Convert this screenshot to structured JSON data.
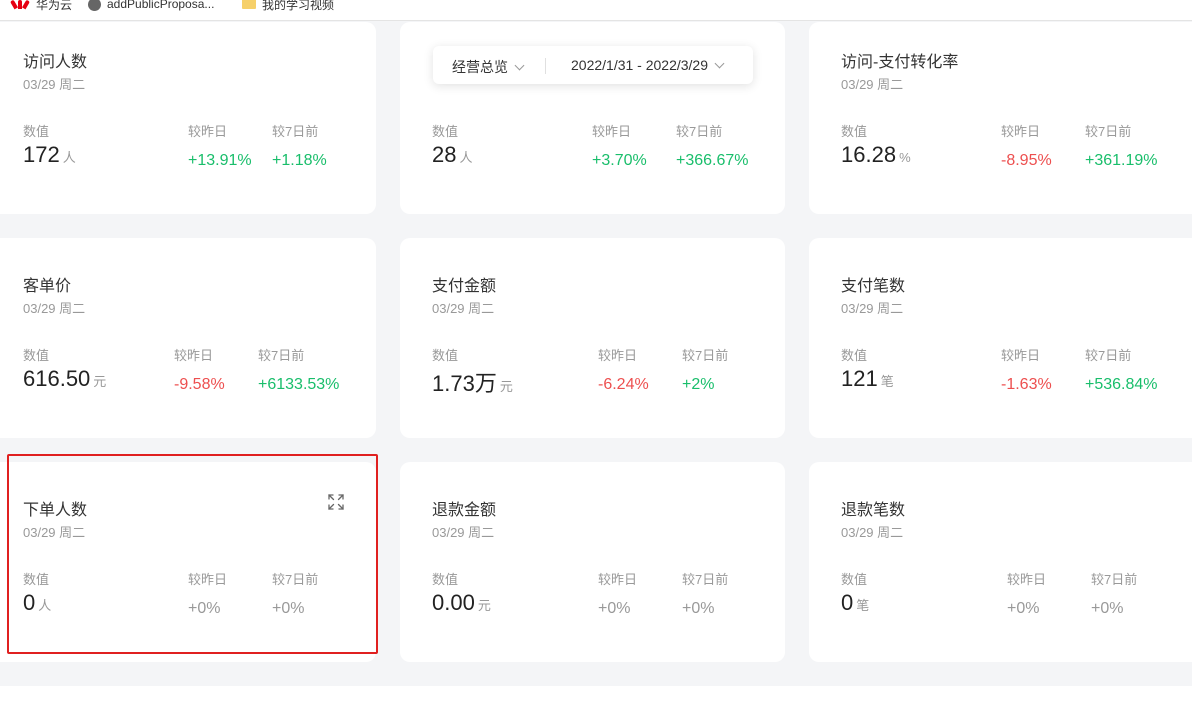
{
  "bookmarks": [
    {
      "label": "华为云",
      "icon": "huawei-icon"
    },
    {
      "label": "addPublicProposa...",
      "icon": "globe-icon"
    },
    {
      "label": "我的学习视频",
      "icon": "folder-icon"
    }
  ],
  "filter": {
    "select_label": "经营总览",
    "date_range": "2022/1/31 - 2022/3/29"
  },
  "labels": {
    "value": "数值",
    "vs_yesterday": "较昨日",
    "vs_7days": "较7日前"
  },
  "cards": [
    {
      "title": "访问人数",
      "date": "03/29 周二",
      "value": "172",
      "unit": "人",
      "day": "+13.91%",
      "week": "+1.18%"
    },
    {
      "title": "",
      "date": "",
      "value": "28",
      "unit": "人",
      "day": "+3.70%",
      "week": "+366.67%"
    },
    {
      "title": "访问-支付转化率",
      "date": "03/29 周二",
      "value": "16.28",
      "unit": "%",
      "day": "-8.95%",
      "week": "+361.19%"
    },
    {
      "title": "客单价",
      "date": "03/29 周二",
      "value": "616.50",
      "unit": "元",
      "day": "-9.58%",
      "week": "+6133.53%"
    },
    {
      "title": "支付金额",
      "date": "03/29 周二",
      "value": "1.73万",
      "unit": "元",
      "day": "-6.24%",
      "week": "+2%"
    },
    {
      "title": "支付笔数",
      "date": "03/29 周二",
      "value": "121",
      "unit": "笔",
      "day": "-1.63%",
      "week": "+536.84%"
    },
    {
      "title": "下单人数",
      "date": "03/29 周二",
      "value": "0",
      "unit": "人",
      "day": "+0%",
      "week": "+0%"
    },
    {
      "title": "退款金额",
      "date": "03/29 周二",
      "value": "0.00",
      "unit": "元",
      "day": "+0%",
      "week": "+0%"
    },
    {
      "title": "退款笔数",
      "date": "03/29 周二",
      "value": "0",
      "unit": "笔",
      "day": "+0%",
      "week": "+0%"
    }
  ],
  "colors": {
    "up": "#19be6b",
    "down": "#ed4f4f",
    "flat": "#999999",
    "highlight": "#e02020"
  }
}
